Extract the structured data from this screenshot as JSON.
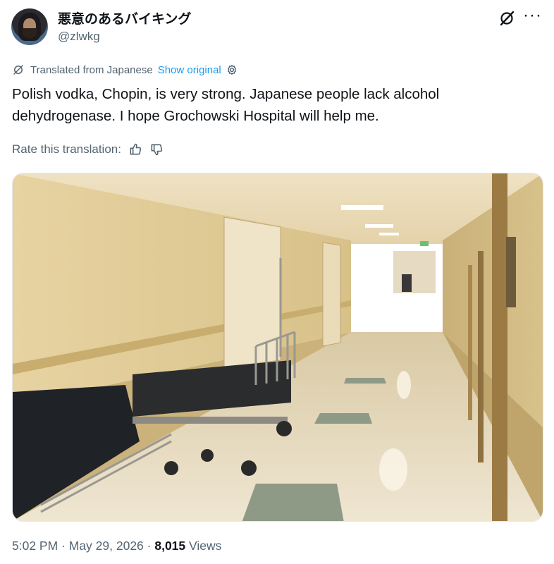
{
  "author": {
    "display_name": "悪意のあるバイキング",
    "handle": "@zlwkg",
    "avatar_icon": "avatar-image"
  },
  "header_icons": [
    "grok-icon",
    "more-icon"
  ],
  "more_label": "···",
  "translation": {
    "label": "Translated from Japanese",
    "show_original": "Show original",
    "icon": "translate-icon",
    "settings_icon": "gear-icon",
    "link_color": "#1d9bf0"
  },
  "tweet": {
    "text": "Polish vodka, Chopin, is very strong. Japanese people lack alcohol dehydrogenase. I hope Grochowski Hospital will help me."
  },
  "rate": {
    "label": "Rate this translation:",
    "up_icon": "thumbs-up-icon",
    "down_icon": "thumbs-down-icon"
  },
  "media": {
    "description_icon": "hospital-corridor-photo"
  },
  "meta": {
    "time": "5:02 PM",
    "sep1": " · ",
    "date": "May 29, 2026",
    "sep2": " · ",
    "views_count": "8,015",
    "views_label": " Views"
  }
}
